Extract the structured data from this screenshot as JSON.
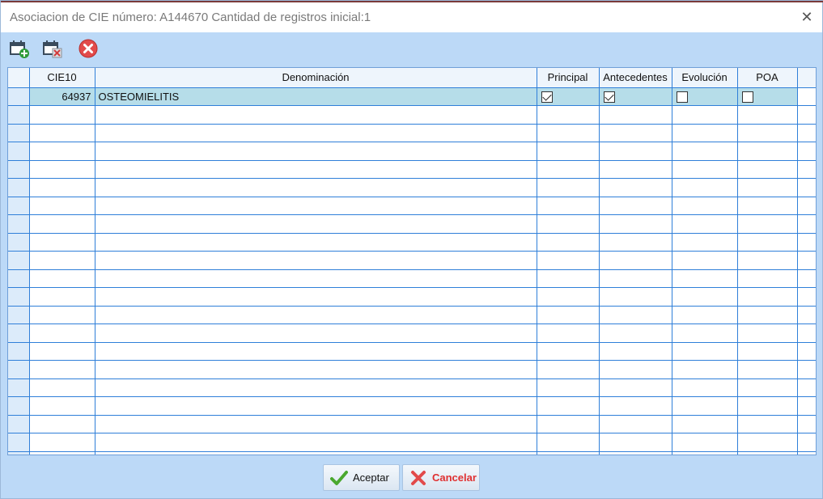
{
  "window": {
    "title": "Asociacion de CIE número: A144670 Cantidad de registros inicial:1",
    "close_glyph": "✕"
  },
  "toolbar": {
    "buttons": [
      {
        "icon": "calendar-add-icon"
      },
      {
        "icon": "calendar-delete-icon"
      },
      {
        "icon": "close-circle-icon"
      }
    ]
  },
  "grid": {
    "columns": [
      "CIE10",
      "Denominación",
      "Principal",
      "Antecedentes",
      "Evolución",
      "POA"
    ],
    "rows": [
      {
        "cie10": "64937",
        "denominacion": "OSTEOMIELITIS",
        "principal": true,
        "antecedentes": true,
        "evolucion": false,
        "poa": false
      }
    ]
  },
  "footer": {
    "accept_label": "Aceptar",
    "cancel_label": "Cancelar"
  },
  "colors": {
    "window_bg": "#bcd9f7",
    "grid_line": "#2f7fd9",
    "selected_row": "#b6dde9",
    "cancel_text": "#e03030"
  }
}
